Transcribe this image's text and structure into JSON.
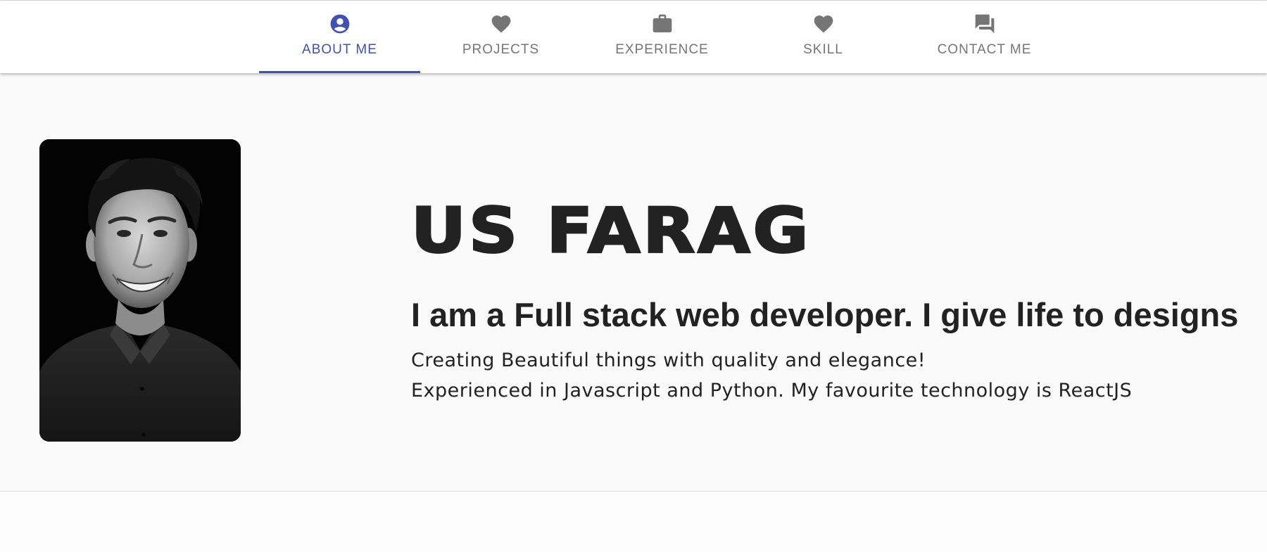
{
  "nav": {
    "tabs": [
      {
        "label": "ABOUT ME",
        "icon": "account-circle-icon",
        "active": true
      },
      {
        "label": "PROJECTS",
        "icon": "heart-icon",
        "active": false
      },
      {
        "label": "EXPERIENCE",
        "icon": "briefcase-icon",
        "active": false
      },
      {
        "label": "SKILL",
        "icon": "heart-icon",
        "active": false
      },
      {
        "label": "CONTACT ME",
        "icon": "forum-icon",
        "active": false
      }
    ]
  },
  "profile": {
    "photo_alt": "profile-photo",
    "name": "US FARAG",
    "tagline": "I am a Full stack web developer. I give life to designs",
    "description_lines": [
      "Creating Beautiful things with quality and elegance!",
      "Experienced in Javascript and Python. My favourite technology is ReactJS"
    ]
  },
  "colors": {
    "accent": "#3f51b5",
    "tab_inactive": "#757575",
    "text": "#222222",
    "background": "#fafafa"
  }
}
